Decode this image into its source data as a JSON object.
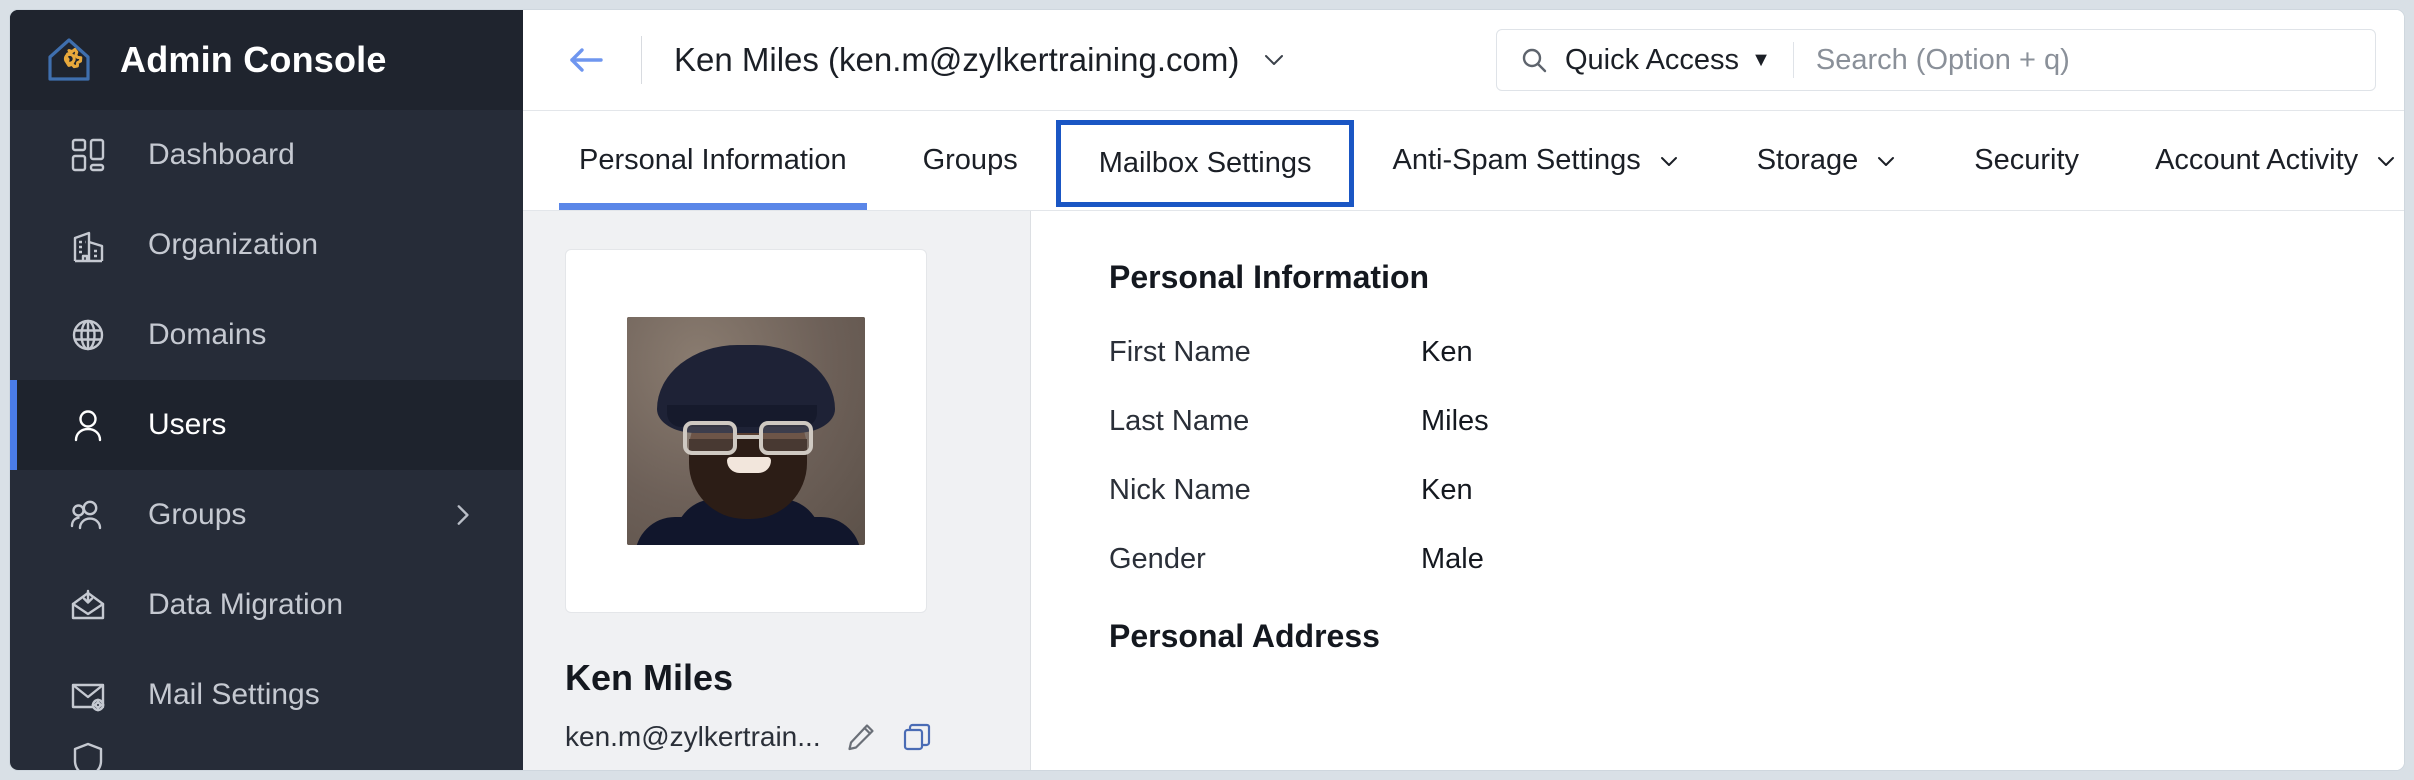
{
  "sidebar": {
    "brand": {
      "title": "Admin Console",
      "logo_icon": "house-gear-icon"
    },
    "items": [
      {
        "label": "Dashboard",
        "icon": "dashboard-grid-icon",
        "active": false,
        "chevron": false
      },
      {
        "label": "Organization",
        "icon": "building-icon",
        "active": false,
        "chevron": false
      },
      {
        "label": "Domains",
        "icon": "globe-icon",
        "active": false,
        "chevron": false
      },
      {
        "label": "Users",
        "icon": "user-icon",
        "active": true,
        "chevron": false
      },
      {
        "label": "Groups",
        "icon": "group-people-icon",
        "active": false,
        "chevron": true
      },
      {
        "label": "Data Migration",
        "icon": "import-envelope-icon",
        "active": false,
        "chevron": false
      },
      {
        "label": "Mail Settings",
        "icon": "envelope-gear-icon",
        "active": false,
        "chevron": false
      }
    ]
  },
  "topbar": {
    "back_icon": "back-arrow-icon",
    "title": "Ken Miles (ken.m@zylkertraining.com)",
    "title_caret_icon": "chevron-down-icon",
    "search": {
      "search_icon": "search-icon",
      "quick_access_label": "Quick Access",
      "quick_access_caret": "▼",
      "placeholder": "Search (Option + q)",
      "value": ""
    }
  },
  "tabs": [
    {
      "label": "Personal Information",
      "active": true,
      "focused": false,
      "caret": false
    },
    {
      "label": "Groups",
      "active": false,
      "focused": false,
      "caret": false
    },
    {
      "label": "Mailbox Settings",
      "active": false,
      "focused": true,
      "caret": false
    },
    {
      "label": "Anti-Spam Settings",
      "active": false,
      "focused": false,
      "caret": true
    },
    {
      "label": "Storage",
      "active": false,
      "focused": false,
      "caret": true
    },
    {
      "label": "Security",
      "active": false,
      "focused": false,
      "caret": false
    },
    {
      "label": "Account Activity",
      "active": false,
      "focused": false,
      "caret": true
    }
  ],
  "profile": {
    "photo_alt": "user-avatar-photo",
    "name": "Ken Miles",
    "email_truncated": "ken.m@zylkertrain...",
    "edit_icon": "pencil-edit-icon",
    "copy_icon": "copy-icon"
  },
  "main": {
    "personal_information_title": "Personal Information",
    "fields": [
      {
        "label": "First Name",
        "value": "Ken"
      },
      {
        "label": "Last Name",
        "value": "Miles"
      },
      {
        "label": "Nick Name",
        "value": "Ken"
      },
      {
        "label": "Gender",
        "value": "Male"
      }
    ],
    "personal_address_title": "Personal Address"
  },
  "colors": {
    "sidebar_bg": "#262c38",
    "sidebar_brand_bg": "#1f242e",
    "accent_blue": "#5a86e8",
    "focus_blue": "#1a56c4",
    "logo_gear": "#e8a93c",
    "panel_gray": "#f0f1f3"
  }
}
